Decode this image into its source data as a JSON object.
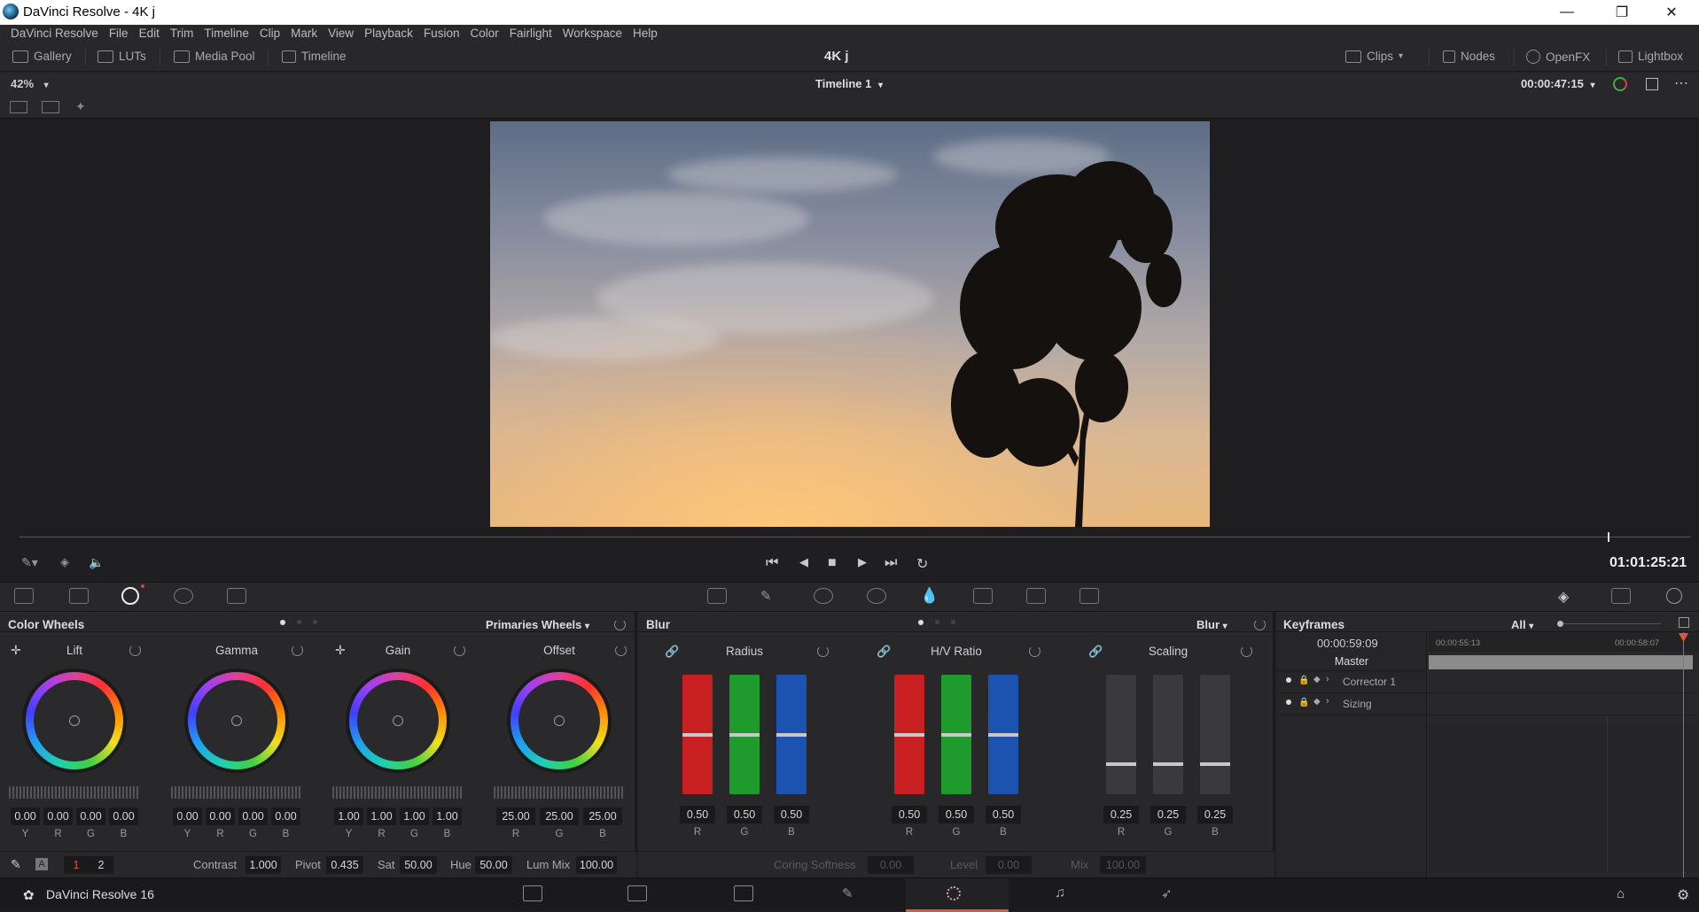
{
  "window": {
    "title": "DaVinci Resolve - 4K j",
    "minimize": "—",
    "maximize": "❐",
    "close": "✕"
  },
  "menu": [
    "DaVinci Resolve",
    "File",
    "Edit",
    "Trim",
    "Timeline",
    "Clip",
    "Mark",
    "View",
    "Playback",
    "Fusion",
    "Color",
    "Fairlight",
    "Workspace",
    "Help"
  ],
  "toolbar": {
    "left": [
      "Gallery",
      "LUTs",
      "Media Pool",
      "Timeline"
    ],
    "project": "4K j",
    "right": [
      "Clips",
      "Nodes",
      "OpenFX",
      "Lightbox"
    ]
  },
  "viewer": {
    "zoom": "42%",
    "timeline": "Timeline 1",
    "timecode": "00:00:47:15",
    "playhead_fraction": 0.95
  },
  "transport": {
    "timecode": "01:01:25:21",
    "icons": [
      "skip-start-icon",
      "step-back-icon",
      "stop-icon",
      "play-icon",
      "skip-end-icon",
      "loop-icon"
    ]
  },
  "color_wheels": {
    "title": "Color Wheels",
    "mode": "Primaries Wheels",
    "wheels": [
      {
        "label": "Lift",
        "values": [
          "0.00",
          "0.00",
          "0.00",
          "0.00"
        ],
        "channels": [
          "Y",
          "R",
          "G",
          "B"
        ]
      },
      {
        "label": "Gamma",
        "values": [
          "0.00",
          "0.00",
          "0.00",
          "0.00"
        ],
        "channels": [
          "Y",
          "R",
          "G",
          "B"
        ]
      },
      {
        "label": "Gain",
        "values": [
          "1.00",
          "1.00",
          "1.00",
          "1.00"
        ],
        "channels": [
          "Y",
          "R",
          "G",
          "B"
        ]
      },
      {
        "label": "Offset",
        "values": [
          "25.00",
          "25.00",
          "25.00"
        ],
        "channels": [
          "R",
          "G",
          "B"
        ]
      }
    ],
    "bottom": {
      "page1": "1",
      "page2": "2",
      "contrast_label": "Contrast",
      "contrast": "1.000",
      "pivot_label": "Pivot",
      "pivot": "0.435",
      "sat_label": "Sat",
      "sat": "50.00",
      "hue_label": "Hue",
      "hue": "50.00",
      "lummix_label": "Lum Mix",
      "lummix": "100.00"
    }
  },
  "blur": {
    "title": "Blur",
    "mode": "Blur",
    "groups": [
      {
        "label": "Radius",
        "values": [
          "0.50",
          "0.50",
          "0.50"
        ],
        "channels": [
          "R",
          "G",
          "B"
        ],
        "level": 0.5
      },
      {
        "label": "H/V Ratio",
        "values": [
          "0.50",
          "0.50",
          "0.50"
        ],
        "channels": [
          "R",
          "G",
          "B"
        ],
        "level": 0.5
      },
      {
        "label": "Scaling",
        "values": [
          "0.25",
          "0.25",
          "0.25"
        ],
        "channels": [
          "R",
          "G",
          "B"
        ],
        "level": 0.25
      }
    ],
    "bottom": {
      "coring_label": "Coring Softness",
      "coring": "0.00",
      "level_label": "Level",
      "level": "0.00",
      "mix_label": "Mix",
      "mix": "100.00"
    }
  },
  "keyframes": {
    "title": "Keyframes",
    "filter": "All",
    "current": "00:00:59:09",
    "t1": "00:00:55:13",
    "t2": "00:00:58:07",
    "rows": [
      "Master",
      "Corrector 1",
      "Sizing"
    ]
  },
  "pagebar": {
    "app": "DaVinci Resolve 16"
  },
  "colors": {
    "accent": "#e0543c",
    "panel": "#28282a"
  }
}
